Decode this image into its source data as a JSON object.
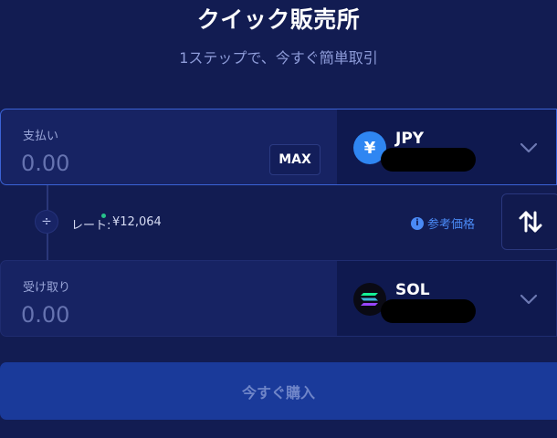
{
  "header": {
    "title": "クイック販売所",
    "subtitle": "1ステップで、今すぐ簡単取引"
  },
  "pay": {
    "label": "支払い",
    "amount_placeholder": "0.00",
    "max_label": "MAX",
    "currency": {
      "symbol": "JPY",
      "icon_glyph": "¥",
      "icon_color": "#2f86f2",
      "icon": "yen-icon"
    }
  },
  "rate": {
    "label": "レート:",
    "value": "¥12,064",
    "reference_label": "参考価格",
    "reference_icon": "info-icon"
  },
  "receive": {
    "label": "受け取り",
    "amount_placeholder": "0.00",
    "currency": {
      "symbol": "SOL",
      "icon": "solana-icon"
    }
  },
  "actions": {
    "buy_label": "今すぐ購入",
    "swap_icon": "swap-arrows-icon"
  },
  "colors": {
    "background": "#121c52",
    "card": "#172363",
    "card_active_border": "#3b63d6",
    "accent_blue": "#4a8af5",
    "buy_button": "#1a3a9a"
  }
}
